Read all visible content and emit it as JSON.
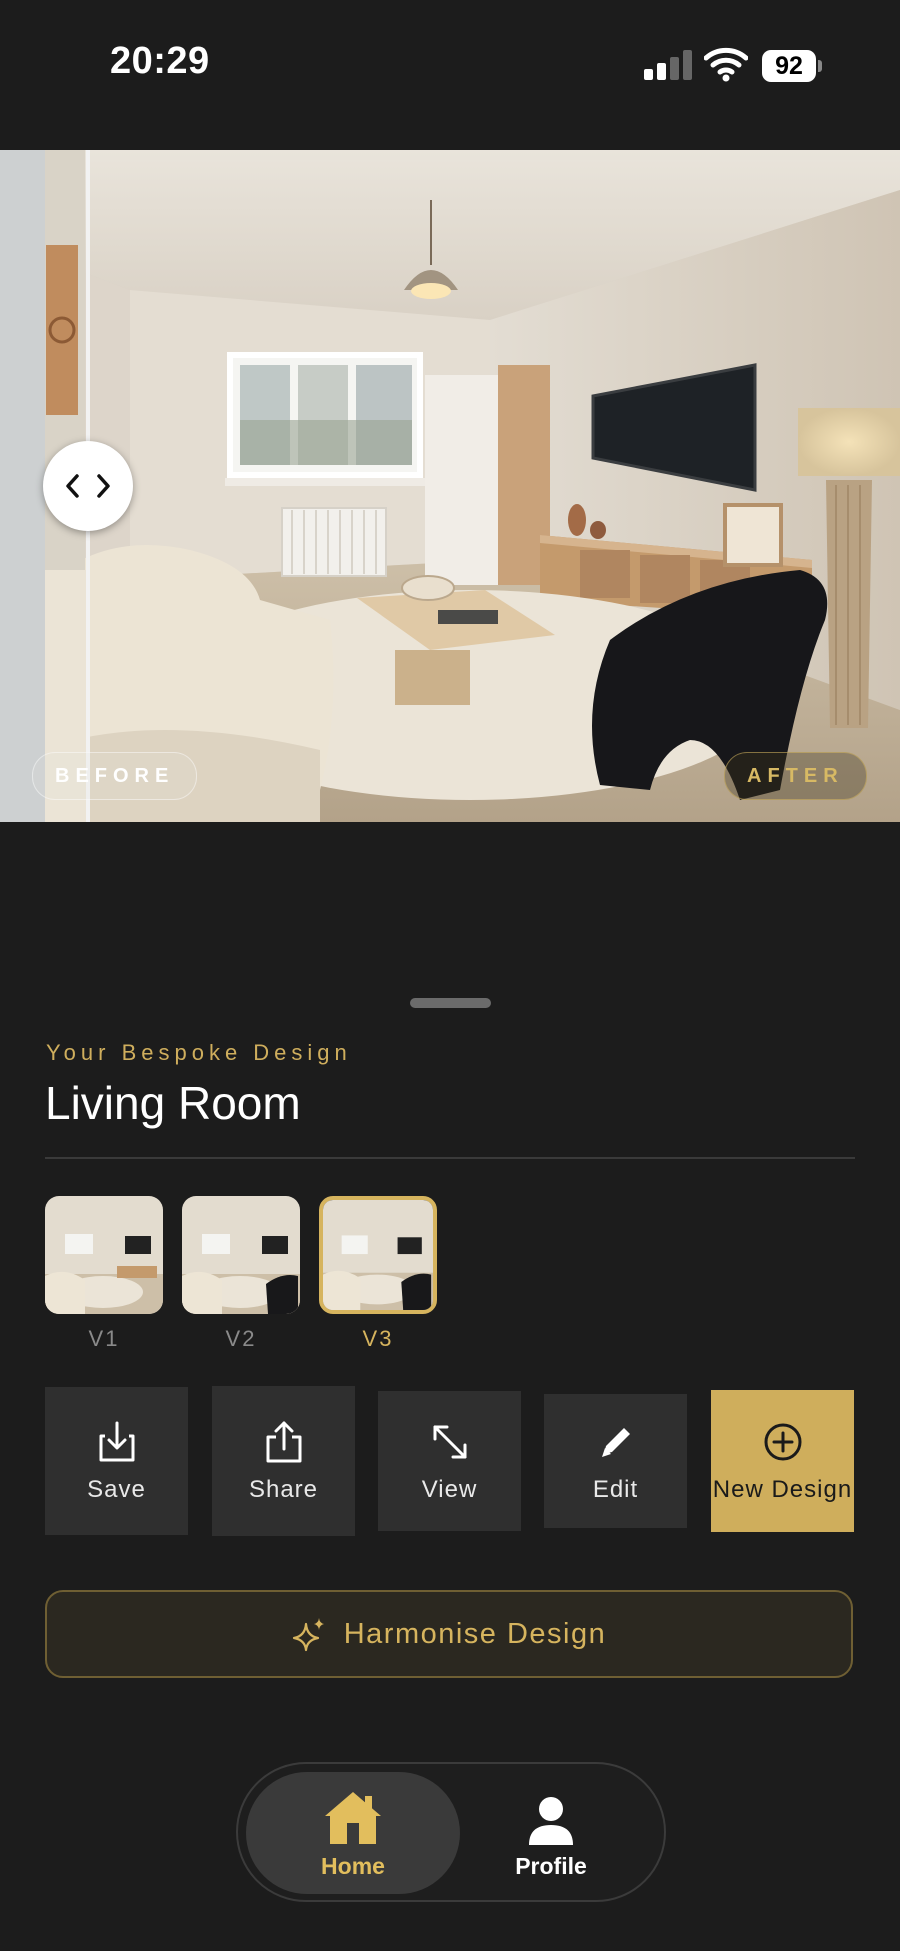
{
  "status_bar": {
    "time": "20:29",
    "battery": "92",
    "signal_bars": 2
  },
  "compare": {
    "before_label": "BEFORE",
    "after_label": "AFTER"
  },
  "sheet": {
    "eyebrow": "Your Bespoke Design",
    "title": "Living Room",
    "versions": [
      {
        "label": "V1",
        "selected": false
      },
      {
        "label": "V2",
        "selected": false
      },
      {
        "label": "V3",
        "selected": true
      }
    ],
    "actions": [
      {
        "label": "Save",
        "icon": "download-icon"
      },
      {
        "label": "Share",
        "icon": "share-icon"
      },
      {
        "label": "View",
        "icon": "expand-icon"
      },
      {
        "label": "Edit",
        "icon": "pencil-icon"
      },
      {
        "label": "New Design",
        "icon": "plus-circle-icon"
      }
    ],
    "harmonise_label": "Harmonise Design"
  },
  "tab_bar": {
    "items": [
      {
        "label": "Home",
        "icon": "home-icon",
        "active": true
      },
      {
        "label": "Profile",
        "icon": "person-icon",
        "active": false
      }
    ]
  },
  "colors": {
    "accent": "#d6b45e",
    "background": "#1c1c1c",
    "button": "#2f2f2f"
  }
}
